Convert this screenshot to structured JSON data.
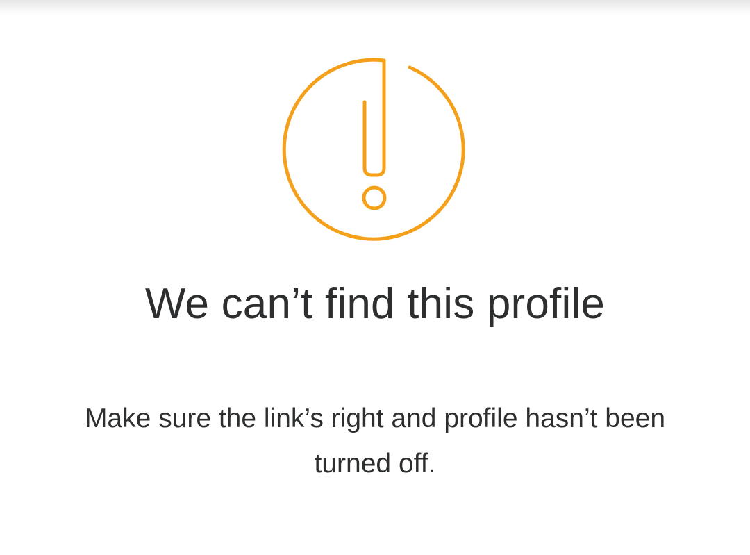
{
  "colors": {
    "accent": "#f5a01a",
    "text": "#2c2e2f",
    "background": "#ffffff"
  },
  "icon": "exclamation-circle-icon",
  "title": "We can’t find this profile",
  "message": "Make sure the link’s right and profile hasn’t been turned off."
}
